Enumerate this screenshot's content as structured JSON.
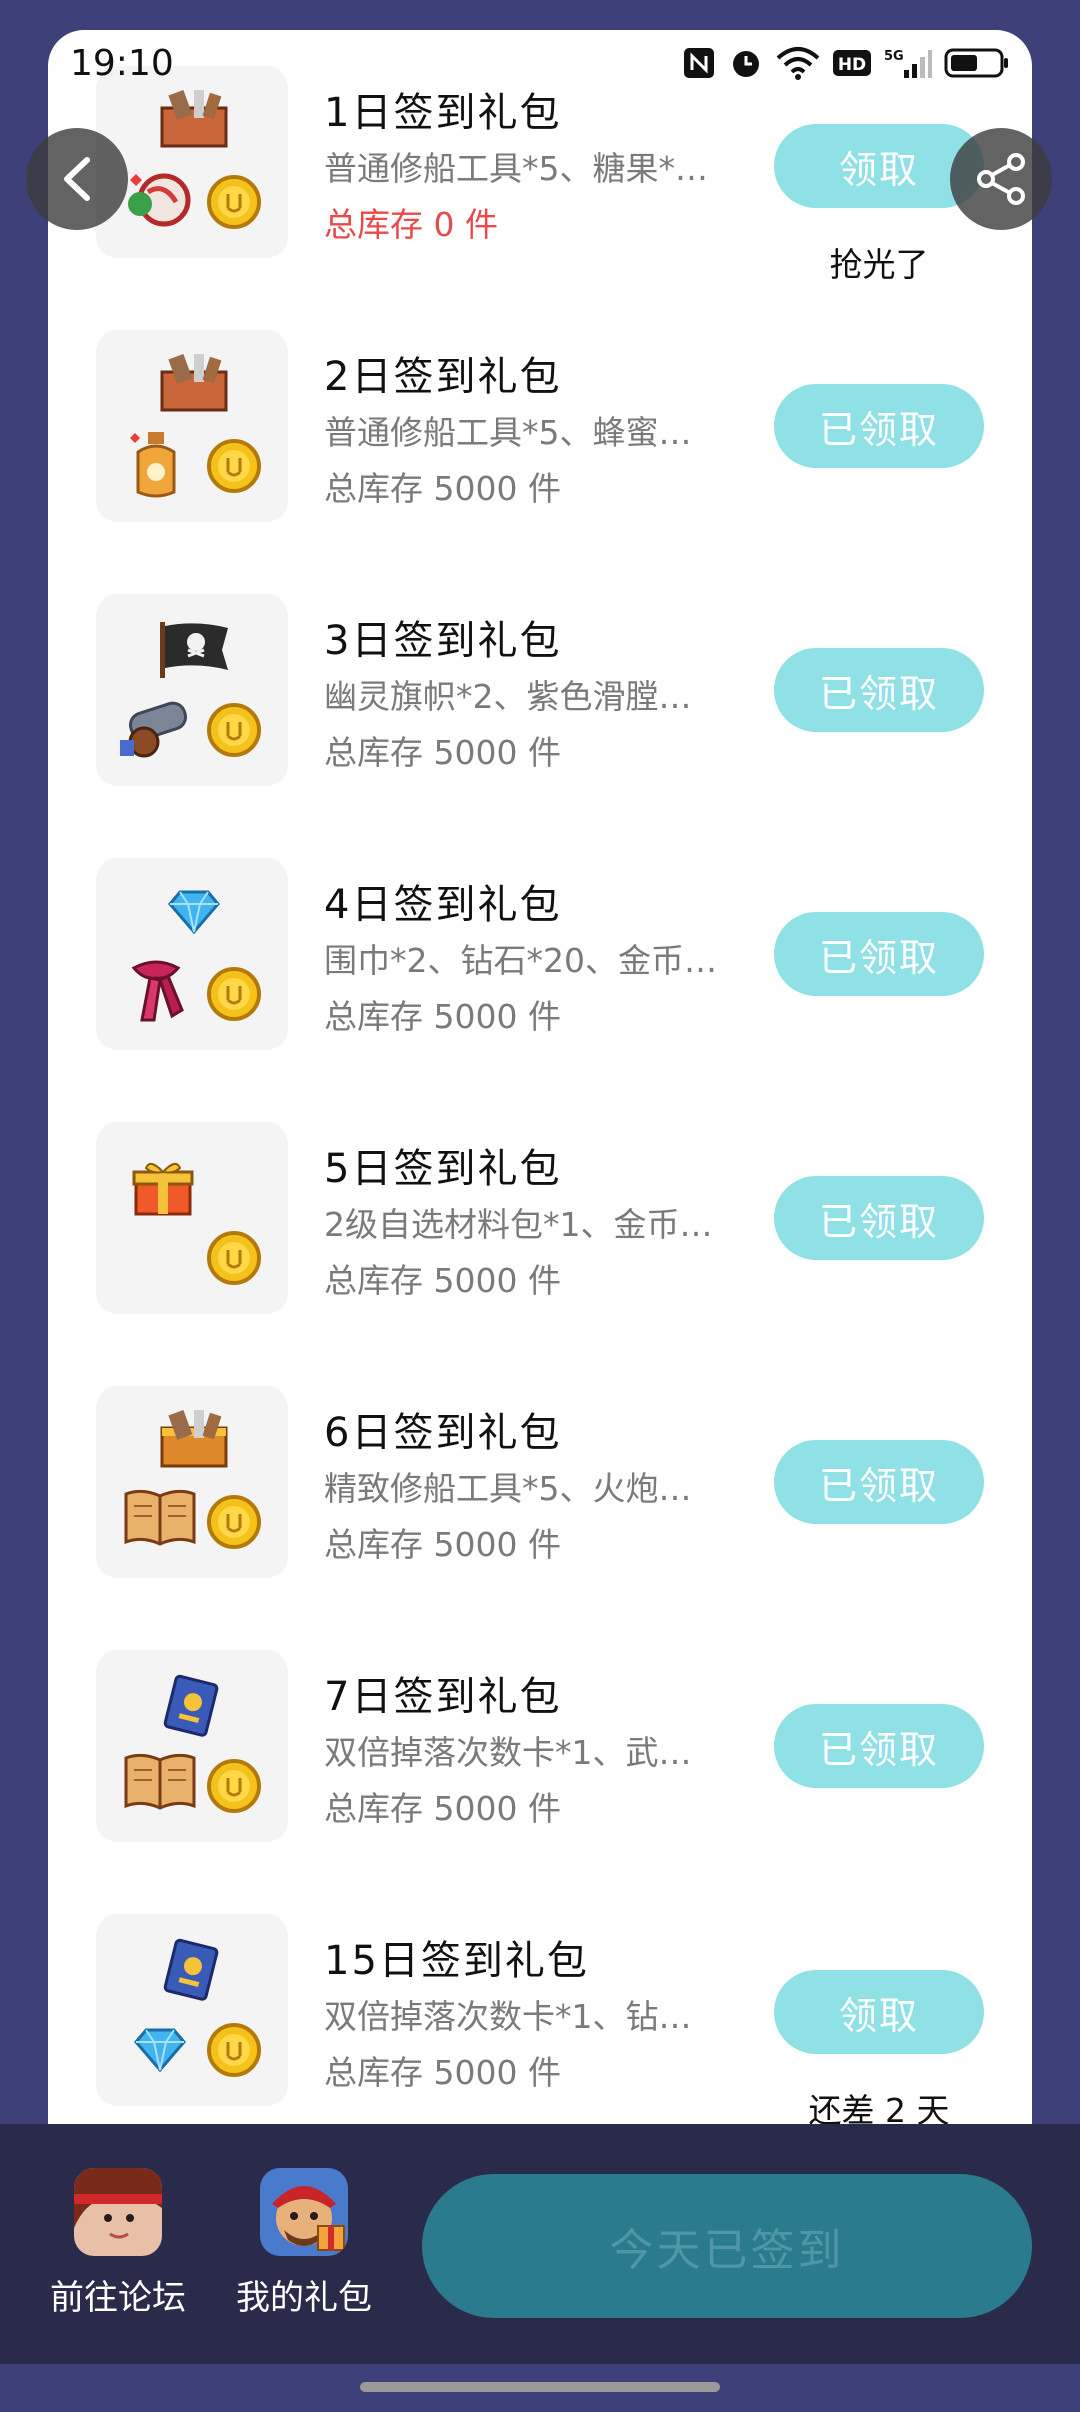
{
  "status": {
    "time": "19:10"
  },
  "gifts": [
    {
      "title": "1日签到礼包",
      "desc": "普通修船工具*5、糖果*…",
      "stock": "总库存 0 件",
      "stock_empty": true,
      "button": "领取",
      "note": "抢光了"
    },
    {
      "title": "2日签到礼包",
      "desc": "普通修船工具*5、蜂蜜…",
      "stock": "总库存 5000 件",
      "button": "已领取"
    },
    {
      "title": "3日签到礼包",
      "desc": "幽灵旗帜*2、紫色滑膛…",
      "stock": "总库存 5000 件",
      "button": "已领取"
    },
    {
      "title": "4日签到礼包",
      "desc": "围巾*2、钻石*20、金币…",
      "stock": "总库存 5000 件",
      "button": "已领取"
    },
    {
      "title": "5日签到礼包",
      "desc": "2级自选材料包*1、金币…",
      "stock": "总库存 5000 件",
      "button": "已领取"
    },
    {
      "title": "6日签到礼包",
      "desc": "精致修船工具*5、火炮…",
      "stock": "总库存 5000 件",
      "button": "已领取"
    },
    {
      "title": "7日签到礼包",
      "desc": "双倍掉落次数卡*1、武…",
      "stock": "总库存 5000 件",
      "button": "已领取"
    },
    {
      "title": "15日签到礼包",
      "desc": "双倍掉落次数卡*1、钻…",
      "stock": "总库存 5000 件",
      "button": "领取",
      "note": "还差 2 天"
    }
  ],
  "bottom": {
    "forum_label": "前往论坛",
    "mygifts_label": "我的礼包",
    "sign_label": "今天已签到"
  },
  "colors": {
    "background": "#3e4179",
    "button": "#8fe1e6",
    "sign_button": "#2a7b8d",
    "stock_empty": "#e94a4a"
  },
  "icons": {
    "back": "chevron-left-icon",
    "share": "share-icon",
    "coin": "coin-icon",
    "toolbox": "toolbox-icon",
    "candy": "candy-icon",
    "honey": "honey-jar-icon",
    "flag": "pirate-flag-icon",
    "cannon": "cannon-icon",
    "diamond": "diamond-icon",
    "scarf": "scarf-icon",
    "gift": "gift-box-icon",
    "book": "book-icon",
    "card": "double-drop-card-icon"
  }
}
